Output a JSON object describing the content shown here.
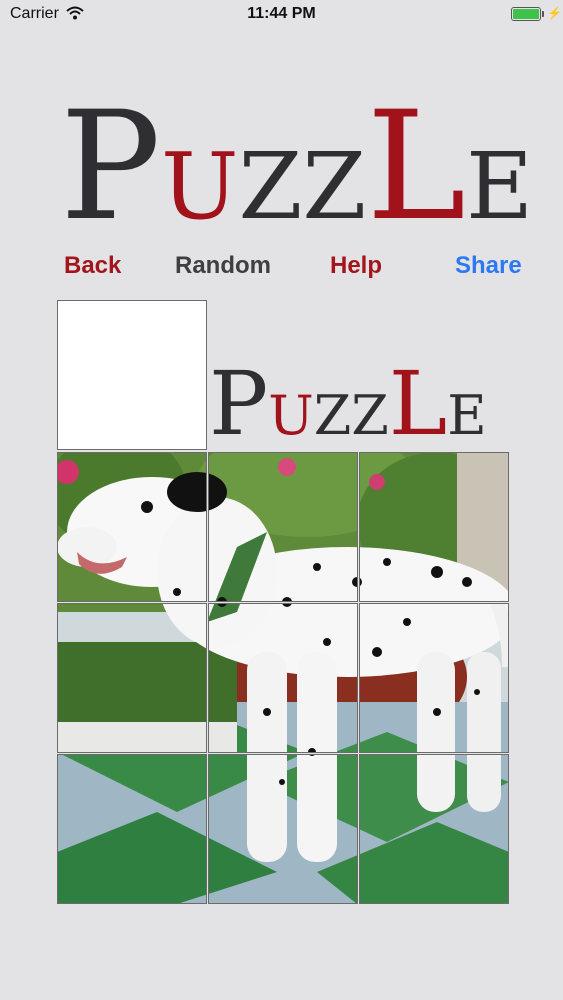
{
  "status_bar": {
    "carrier": "Carrier",
    "time": "11:44 PM"
  },
  "logo": {
    "letters": [
      "P",
      "U",
      "Z",
      "Z",
      "L",
      "E"
    ]
  },
  "nav": {
    "back": "Back",
    "random": "Random",
    "help": "Help",
    "share": "Share"
  },
  "board": {
    "grid": "3x3",
    "empty_slot": "top-left (outside grid)",
    "preview_logo": [
      "P",
      "U",
      "Z",
      "Z",
      "L",
      "E"
    ],
    "image_subject": "dalmatian dog"
  },
  "colors": {
    "accent_red": "#a1121b",
    "dark_text": "#2f2f33",
    "link_blue": "#2d79f3",
    "background": "#e3e3e5"
  },
  "icons": [
    "wifi-icon",
    "battery-icon",
    "charging-bolt-icon"
  ]
}
